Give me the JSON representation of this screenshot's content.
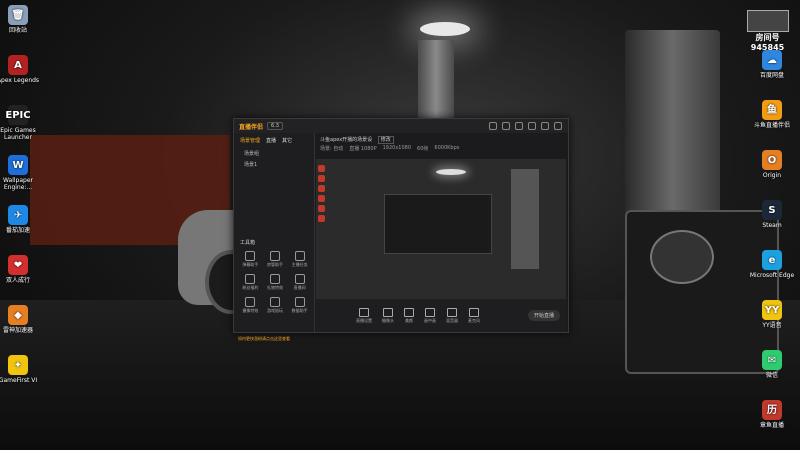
{
  "desktop_left": [
    {
      "label": "回收站",
      "color": "#8aa0b8",
      "glyph": "🗑"
    },
    {
      "label": "Apex Legends",
      "color": "#b22222",
      "glyph": "A"
    },
    {
      "label": "Epic Games Launcher",
      "color": "#222222",
      "glyph": "EPIC"
    },
    {
      "label": "Wallpaper Engine:...",
      "color": "#1e6fd9",
      "glyph": "W"
    },
    {
      "label": "番茄加速",
      "color": "#1e88e5",
      "glyph": "✈"
    },
    {
      "label": "双人成行",
      "color": "#d32f2f",
      "glyph": "❤"
    },
    {
      "label": "雷神加速器",
      "color": "#e67e22",
      "glyph": "◆"
    },
    {
      "label": "GameFirst VI",
      "color": "#f1c40f",
      "glyph": "✦"
    }
  ],
  "desktop_right": [
    {
      "label": "百度网盘",
      "color": "#2e86de",
      "glyph": "☁"
    },
    {
      "label": "斗鱼直播伴侣",
      "color": "#f39c12",
      "glyph": "鱼"
    },
    {
      "label": "Origin",
      "color": "#e67e22",
      "glyph": "O"
    },
    {
      "label": "Steam",
      "color": "#1b2838",
      "glyph": "S"
    },
    {
      "label": "Microsoft Edge",
      "color": "#1ba1e2",
      "glyph": "e"
    },
    {
      "label": "YY语音",
      "color": "#f1c40f",
      "glyph": "YY"
    },
    {
      "label": "微信",
      "color": "#2ecc71",
      "glyph": "✉"
    },
    {
      "label": "章鱼直播",
      "color": "#c0392b",
      "glyph": "历"
    }
  ],
  "watermark": {
    "line1": "房间号",
    "line2": "945845"
  },
  "app": {
    "logo": "直播伴侣",
    "version": "6.3",
    "tabs": [
      "场景管理",
      "直播",
      "其它"
    ],
    "scenes": [
      "场景组",
      "场景1"
    ],
    "preview_title": "斗鱼apex开播的场景设",
    "preview_tag": "修改",
    "preview_meta": [
      "场景: 自动",
      "直播 1080P",
      "1920x1080",
      "60帧",
      "6000Kbps"
    ],
    "tools_title": "工具箱",
    "tools": [
      "弹幕助手",
      "房管助手",
      "主播任务",
      "粉丝福利",
      "礼物特效",
      "直播间",
      "摄像特效",
      "游戏陪玩",
      "数据助手"
    ],
    "notice": "如何更快涨粉请点击这里查看",
    "bottom_buttons": [
      "直播设置",
      "摄像头",
      "美颜",
      "画中画",
      "混音器",
      "麦克风"
    ],
    "live_button": "开始直播"
  }
}
